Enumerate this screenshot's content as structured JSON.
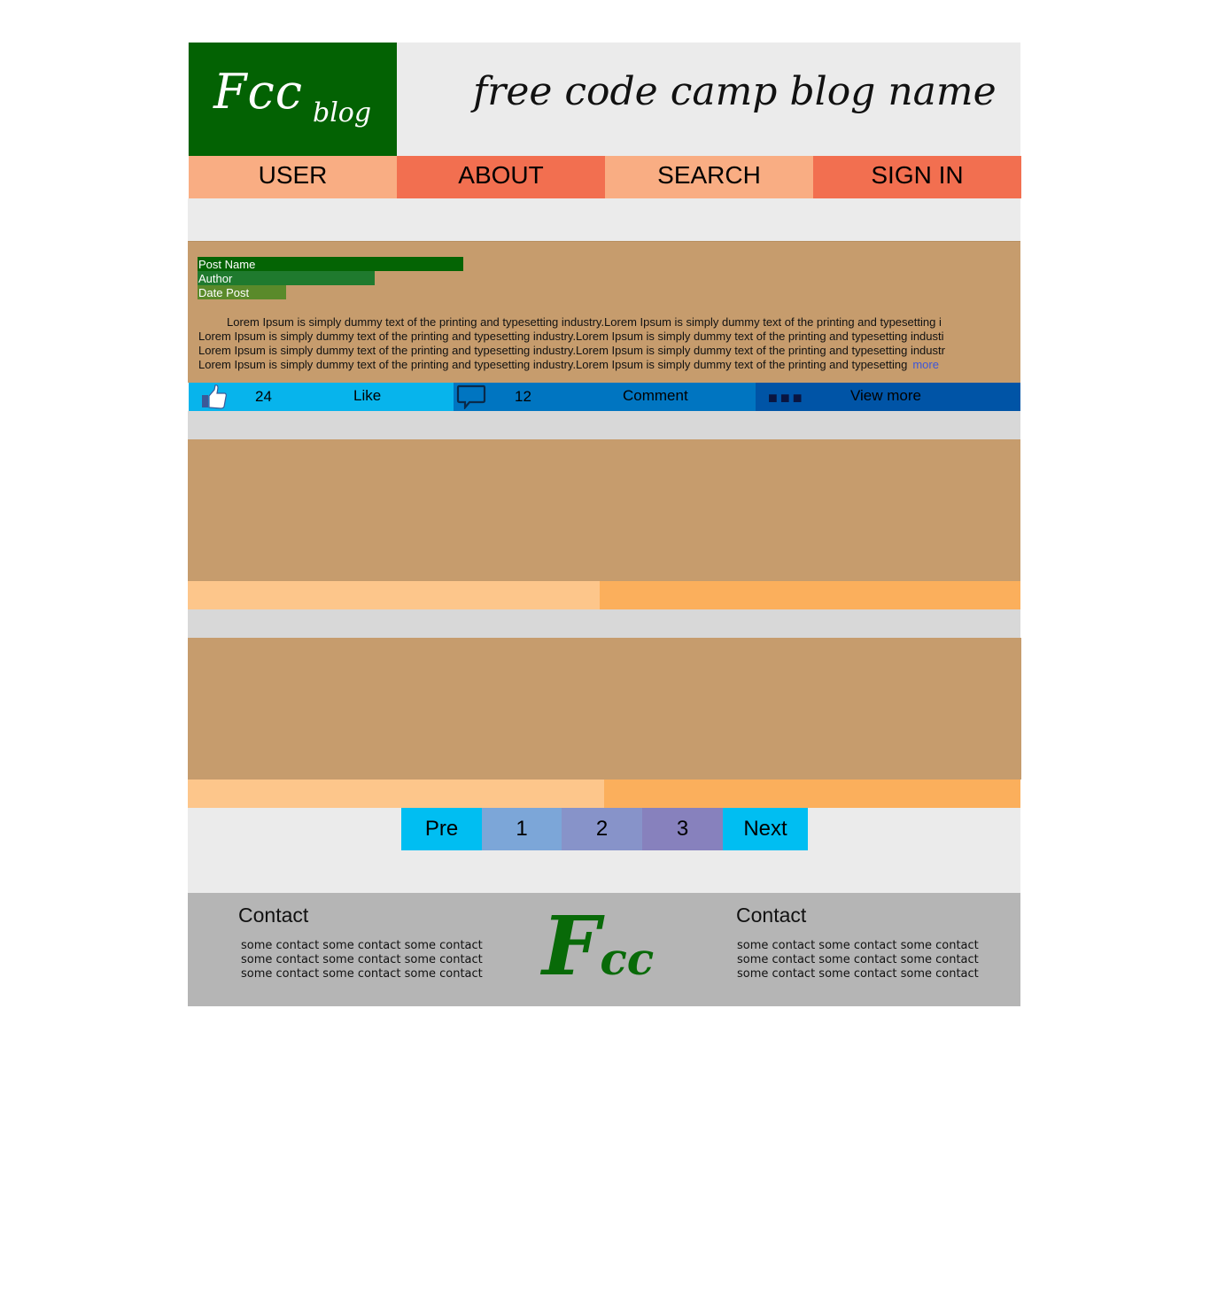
{
  "header": {
    "logo_main": "Fcc",
    "logo_sub": "blog",
    "site_title": "free code camp blog name"
  },
  "nav": {
    "items": [
      {
        "label": "USER"
      },
      {
        "label": "ABOUT"
      },
      {
        "label": "SEARCH"
      },
      {
        "label": "SIGN IN"
      }
    ]
  },
  "post": {
    "name": "Post Name",
    "author": "Author",
    "date": "Date Post",
    "lines": [
      "Lorem Ipsum is simply dummy text of the printing and typesetting industry.Lorem Ipsum is simply dummy text of the printing and typesetting i",
      "Lorem Ipsum is simply dummy text of the printing and typesetting industry.Lorem Ipsum is simply dummy text of the printing and typesetting industi",
      "Lorem Ipsum is simply dummy text of the printing and typesetting industry.Lorem Ipsum is simply dummy text of the printing and typesetting industr",
      "Lorem Ipsum is simply dummy text of the printing and typesetting industry.Lorem Ipsum is simply dummy text of the printing and typesetting"
    ],
    "more_label": "more",
    "like_count": "24",
    "like_label": "Like",
    "comment_count": "12",
    "comment_label": "Comment",
    "view_more_label": "View more"
  },
  "pagination": {
    "pre": "Pre",
    "pages": [
      "1",
      "2",
      "3"
    ],
    "next": "Next"
  },
  "footer": {
    "left_title": "Contact",
    "right_title": "Contact",
    "contact_line": "some contact some contact some contact",
    "logo_F": "F",
    "logo_cc": "cc"
  },
  "icons": {
    "like": "thumbs-up-icon",
    "comment": "speech-bubble-icon",
    "more": "ellipsis-icon"
  },
  "colors": {
    "logo_green": "#036203",
    "nav_light": "#f9ad83",
    "nav_dark": "#f26f50",
    "post_bg": "#c69c6d",
    "like_bar": "#07b4ec",
    "comment_bar": "#0075c1",
    "more_bar": "#0054a6"
  }
}
